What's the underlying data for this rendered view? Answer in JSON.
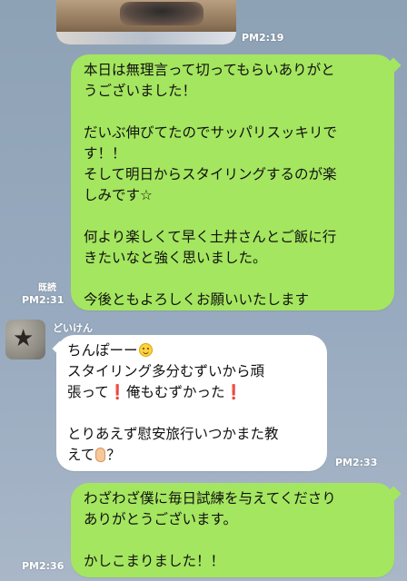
{
  "chat": {
    "messages": [
      {
        "id": "photo",
        "time": "PM2:19"
      },
      {
        "id": "out1",
        "text": "本日は無理言って切ってもらいありがと\nうございました！\n\nだいぶ伸びてたのでサッパリスッキリで\nす！！\nそして明日からスタイリングするのが楽\nしみです☆\n\n何より楽しくて早く土井さんとご飯に行\nきたいなと強く思いました。\n\n今後ともよろしくお願いいたします",
        "read_label": "既読",
        "time": "PM2:31"
      },
      {
        "id": "in1",
        "sender": "どいけん",
        "line1": "ちんぽーー",
        "line2": "スタイリング多分むずいから頑",
        "line3a": "張って",
        "line3b": "俺もむずかった",
        "line4": "とりあえず慰安旅行いつかまた教",
        "line5a": "えて",
        "line5b": "？",
        "excl": "❗",
        "time": "PM2:33"
      },
      {
        "id": "out2",
        "text": "わざわざ僕に毎日試練を与えてくださり\nありがとうございます。\n\nかしこまりました！！",
        "time": "PM2:36"
      }
    ]
  },
  "icons": {
    "smile": "smiling-face-emoji",
    "exclamation": "red-exclamation-emoji",
    "ear": "ear-emoji",
    "avatar_star": "star-avatar"
  }
}
